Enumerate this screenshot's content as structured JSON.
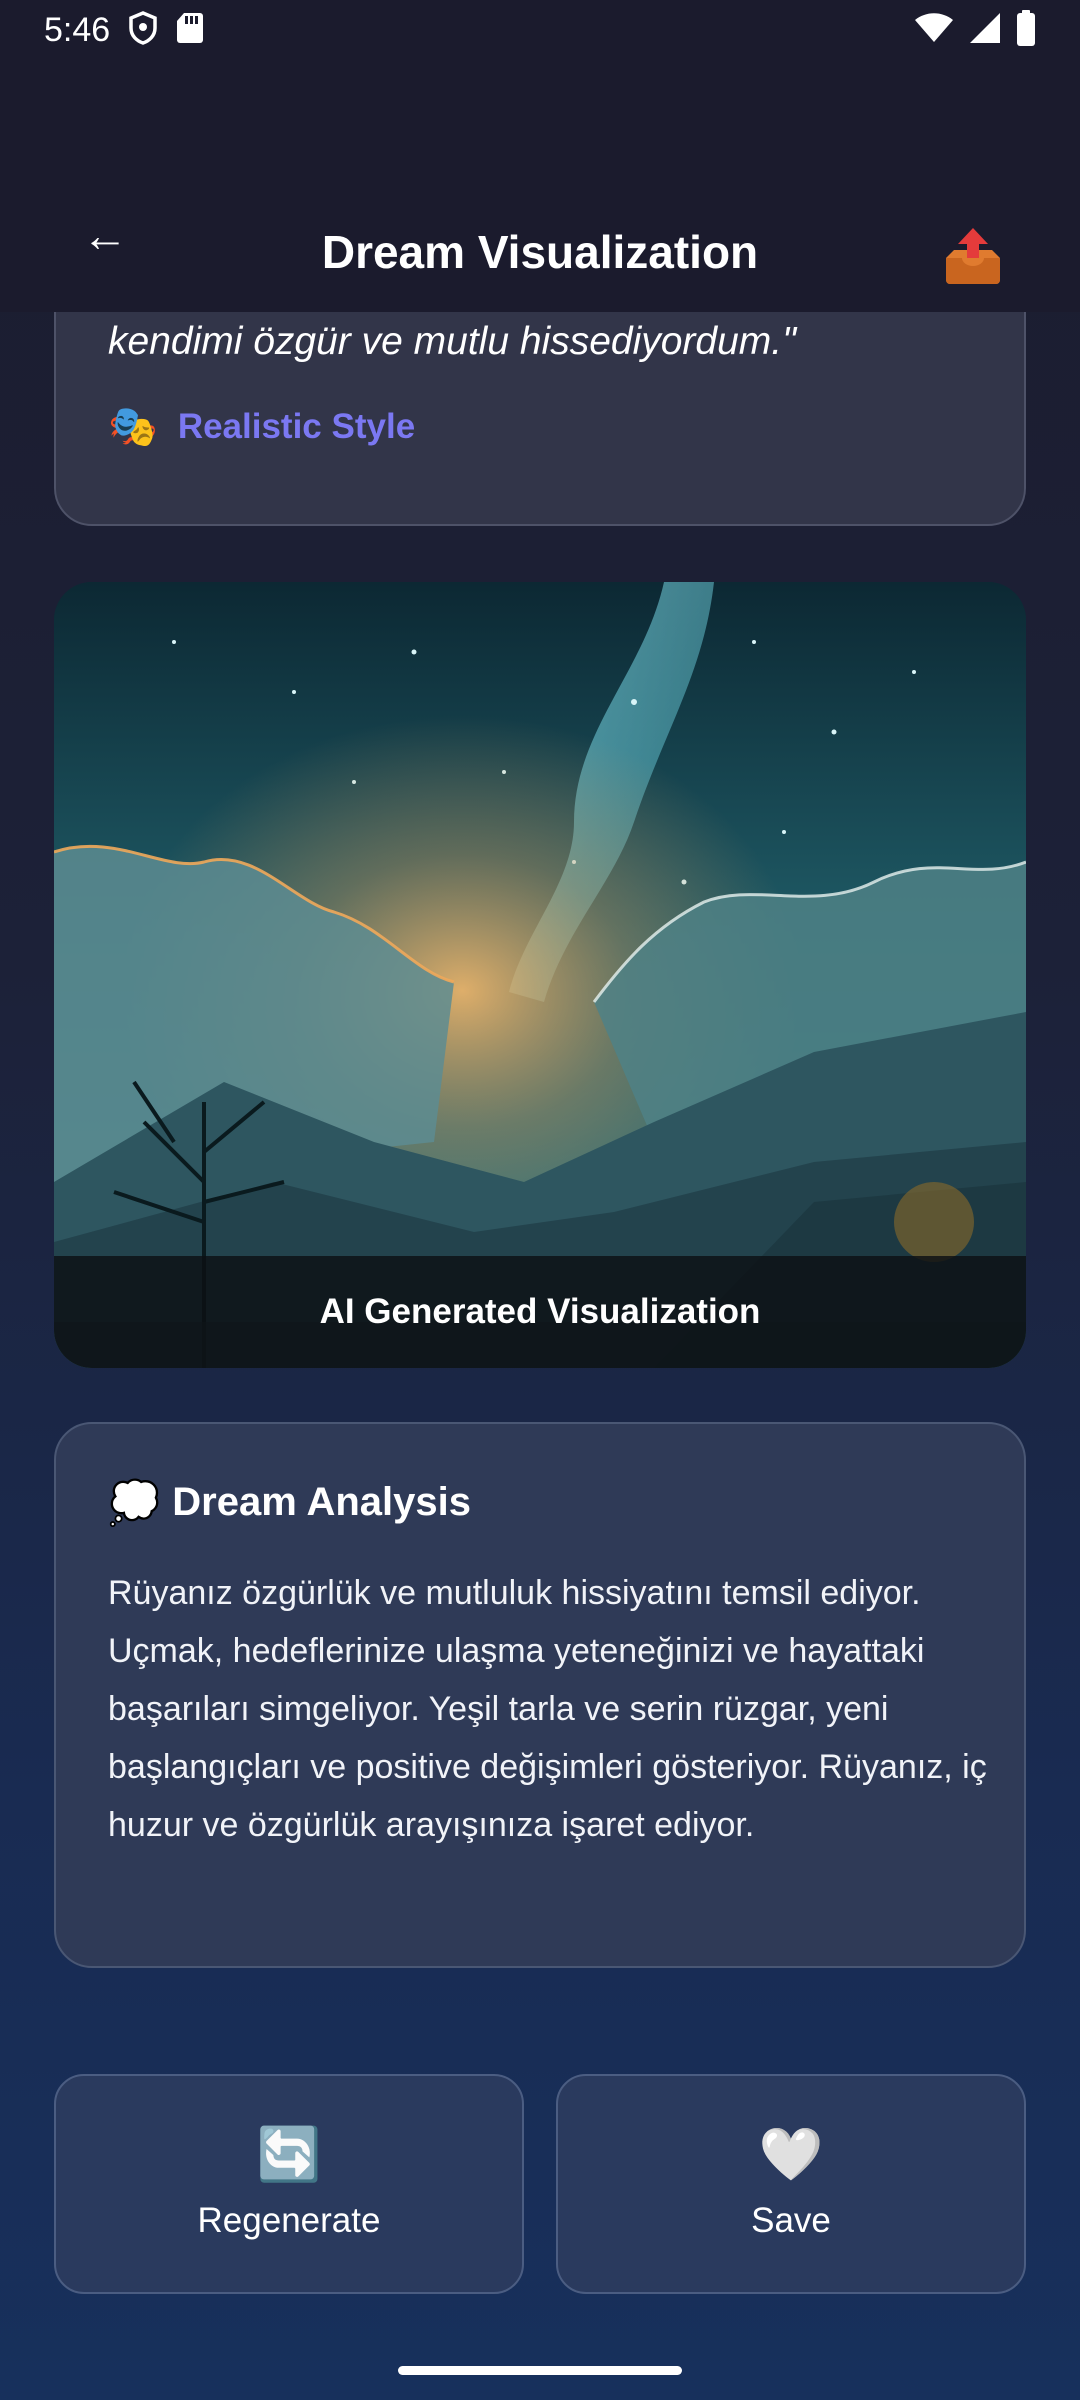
{
  "status_bar": {
    "time": "5:46"
  },
  "header": {
    "title": "Dream Visualization",
    "back_icon": "←",
    "share_icon": "📤"
  },
  "dream_card": {
    "text": "kendimi özgür ve mutlu hissediyordum.\"",
    "style_icon": "🎭",
    "style_label": "Realistic Style"
  },
  "image": {
    "caption": "AI Generated Visualization"
  },
  "analysis": {
    "icon": "💭",
    "title": "Dream Analysis",
    "body": "Rüyanız özgürlük ve mutluluk hissiyatını temsil ediyor. Uçmak, hedeflerinize ulaşma yeteneğinizi ve hayattaki başarıları simgeliyor. Yeşil tarla ve serin rüzgar, yeni başlangıçları ve positive değişimleri gösteriyor. Rüyanız, iç huzur ve özgürlük arayışınıza işaret ediyor."
  },
  "actions": {
    "regenerate": {
      "icon": "🔄",
      "label": "Regenerate"
    },
    "save": {
      "icon": "🤍",
      "label": "Save"
    }
  },
  "colors": {
    "accent": "#7b78f2",
    "card": "#323549",
    "background_top": "#1b1c2e",
    "background_bottom": "#17305c"
  }
}
